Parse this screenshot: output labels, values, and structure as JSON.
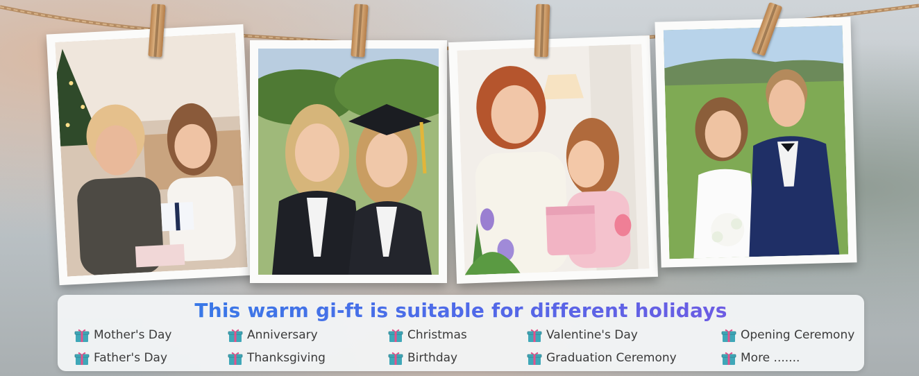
{
  "banner": {
    "title": "This warm gi-ft is suitable for different holidays",
    "holidays": [
      {
        "label": "Mother's Day",
        "icon": "gift-icon"
      },
      {
        "label": "Anniversary",
        "icon": "gift-icon"
      },
      {
        "label": "Christmas",
        "icon": "gift-icon"
      },
      {
        "label": "Valentine's Day",
        "icon": "gift-icon"
      },
      {
        "label": "Opening Ceremony",
        "icon": "gift-icon"
      },
      {
        "label": "Father's Day",
        "icon": "gift-icon"
      },
      {
        "label": "Thanksgiving",
        "icon": "gift-icon"
      },
      {
        "label": "Birthday",
        "icon": "gift-icon"
      },
      {
        "label": "Graduation Ceremony",
        "icon": "gift-icon"
      },
      {
        "label": "More .......",
        "icon": "gift-icon"
      }
    ]
  },
  "colors": {
    "title_gradient_start": "#2f7fe6",
    "title_gradient_end": "#7b55e0",
    "gift_icon": "#3fa7b8",
    "gift_ribbon": "#e5508a"
  },
  "photos": [
    {
      "subject": "mother and daughter with gift by christmas tree"
    },
    {
      "subject": "two graduates in gowns and cap"
    },
    {
      "subject": "mother and daughter with tulips and gift box"
    },
    {
      "subject": "wedding couple in field"
    }
  ]
}
